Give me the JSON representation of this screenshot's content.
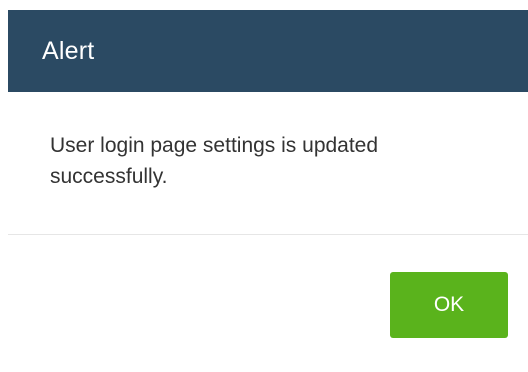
{
  "dialog": {
    "title": "Alert",
    "message": "User login page settings is updated successfully.",
    "ok_label": "OK"
  },
  "colors": {
    "header_background": "#2b4a63",
    "ok_button_background": "#5ab31c"
  }
}
